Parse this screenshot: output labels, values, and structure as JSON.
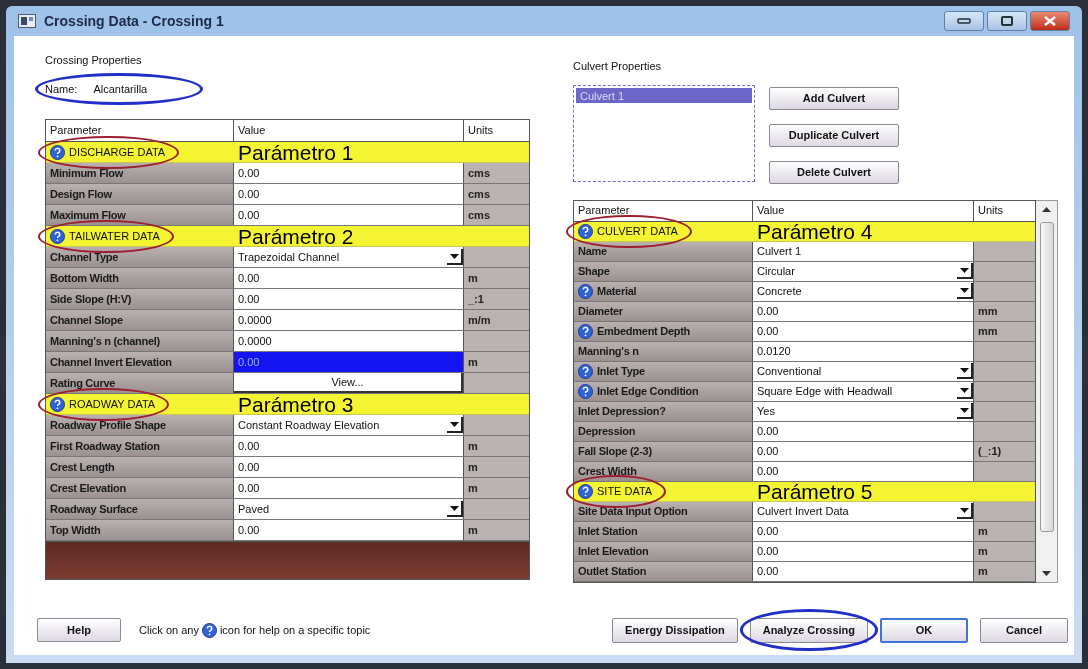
{
  "window": {
    "title": "Crossing Data - Crossing 1"
  },
  "crossing_properties": {
    "title": "Crossing Properties",
    "name_label": "Name:",
    "name": "Alcantarilla",
    "circled": true
  },
  "crossing_table": {
    "columns": [
      "Parameter",
      "Value",
      "Units"
    ],
    "rows": [
      {
        "kind": "header",
        "label": "DISCHARGE DATA",
        "annotation": "Parámetro 1",
        "circled": true,
        "help": true
      },
      {
        "kind": "text",
        "label": "Minimum Flow",
        "value": "0.00",
        "units": "cms",
        "help": false,
        "selected": false
      },
      {
        "kind": "text",
        "label": "Design Flow",
        "value": "0.00",
        "units": "cms",
        "help": false,
        "selected": false
      },
      {
        "kind": "text",
        "label": "Maximum Flow",
        "value": "0.00",
        "units": "cms",
        "help": false,
        "selected": false
      },
      {
        "kind": "header",
        "label": "TAILWATER DATA",
        "annotation": "Parámetro 2",
        "circled": true,
        "help": true
      },
      {
        "kind": "dropdown",
        "label": "Channel Type",
        "value": "Trapezoidal Channel",
        "help": false,
        "selected": false
      },
      {
        "kind": "text",
        "label": "Bottom Width",
        "value": "0.00",
        "units": "m",
        "help": false,
        "selected": false
      },
      {
        "kind": "text",
        "label": "Side Slope (H:V)",
        "value": "0.00",
        "units": "_:1",
        "help": false,
        "selected": false
      },
      {
        "kind": "text",
        "label": "Channel Slope",
        "value": "0.0000",
        "units": "m/m",
        "help": false,
        "selected": false
      },
      {
        "kind": "text",
        "label": "Manning's n (channel)",
        "value": "0.0000",
        "help": false,
        "selected": false
      },
      {
        "kind": "text",
        "label": "Channel Invert Elevation",
        "value": "0.00",
        "units": "m",
        "help": false,
        "selected": true
      },
      {
        "kind": "button",
        "label": "Rating Curve",
        "value": "View...",
        "help": false,
        "selected": false
      },
      {
        "kind": "header",
        "label": "ROADWAY DATA",
        "annotation": "Parámetro 3",
        "circled": true,
        "help": true
      },
      {
        "kind": "dropdown",
        "label": "Roadway Profile Shape",
        "value": "Constant Roadway Elevation",
        "help": false,
        "selected": false
      },
      {
        "kind": "text",
        "label": "First Roadway Station",
        "value": "0.00",
        "units": "m",
        "help": false,
        "selected": false
      },
      {
        "kind": "text",
        "label": "Crest Length",
        "value": "0.00",
        "units": "m",
        "help": false,
        "selected": false
      },
      {
        "kind": "text",
        "label": "Crest Elevation",
        "value": "0.00",
        "units": "m",
        "help": false,
        "selected": false
      },
      {
        "kind": "dropdown",
        "label": "Roadway Surface",
        "value": "Paved",
        "help": false,
        "selected": false
      },
      {
        "kind": "text",
        "label": "Top Width",
        "value": "0.00",
        "units": "m",
        "help": false,
        "selected": false
      }
    ]
  },
  "culvert_properties": {
    "title": "Culvert Properties",
    "culverts": [
      {
        "label": "Culvert 1",
        "selected": true
      }
    ],
    "buttons": [
      "Add Culvert",
      "Duplicate Culvert",
      "Delete Culvert"
    ]
  },
  "culvert_table": {
    "columns": [
      "Parameter",
      "Value",
      "Units"
    ],
    "rows": [
      {
        "kind": "header",
        "label": "CULVERT DATA",
        "annotation": "Parámetro 4",
        "circled": true,
        "help": true
      },
      {
        "kind": "text",
        "label": "Name",
        "value": "Culvert 1",
        "help": false,
        "selected": false
      },
      {
        "kind": "dropdown",
        "label": "Shape",
        "value": "Circular",
        "help": false,
        "selected": false
      },
      {
        "kind": "dropdown",
        "label": "Material",
        "value": "Concrete",
        "help": true,
        "selected": false
      },
      {
        "kind": "text",
        "label": "Diameter",
        "value": "0.00",
        "units": "mm",
        "help": false,
        "selected": false
      },
      {
        "kind": "text",
        "label": "Embedment Depth",
        "value": "0.00",
        "units": "mm",
        "help": true,
        "selected": false
      },
      {
        "kind": "text",
        "label": "Manning's n",
        "value": "0.0120",
        "help": false,
        "selected": false
      },
      {
        "kind": "dropdown",
        "label": "Inlet Type",
        "value": "Conventional",
        "help": true,
        "selected": false
      },
      {
        "kind": "dropdown",
        "label": "Inlet Edge Condition",
        "value": "Square Edge with Headwall",
        "help": true,
        "selected": false
      },
      {
        "kind": "dropdown",
        "label": "Inlet Depression?",
        "value": "Yes",
        "help": false,
        "selected": false
      },
      {
        "kind": "text",
        "label": "Depression",
        "value": "0.00",
        "help": false,
        "selected": false
      },
      {
        "kind": "text",
        "label": "Fall Slope (2-3)",
        "value": "0.00",
        "units": "(_:1)",
        "help": false,
        "selected": false
      },
      {
        "kind": "text",
        "label": "Crest Width",
        "value": "0.00",
        "help": false,
        "selected": false
      },
      {
        "kind": "header",
        "label": "SITE DATA",
        "annotation": "Parámetro 5",
        "circled": true,
        "help": true
      },
      {
        "kind": "dropdown",
        "label": "Site Data Input Option",
        "value": "Culvert Invert Data",
        "help": false,
        "selected": false
      },
      {
        "kind": "text",
        "label": "Inlet Station",
        "value": "0.00",
        "units": "m",
        "help": false,
        "selected": false
      },
      {
        "kind": "text",
        "label": "Inlet Elevation",
        "value": "0.00",
        "units": "m",
        "help": false,
        "selected": false
      },
      {
        "kind": "text",
        "label": "Outlet Station",
        "value": "0.00",
        "units": "m",
        "help": false,
        "selected": false
      }
    ]
  },
  "footer": {
    "help_button": "Help",
    "hint_before": "Click on any",
    "hint_after": "icon for help on a specific topic",
    "buttons": [
      {
        "label": "Energy Dissipation",
        "circled": false,
        "default": false
      },
      {
        "label": "Analyze Crossing",
        "circled": true,
        "default": false
      },
      {
        "label": "OK",
        "circled": false,
        "default": true
      },
      {
        "label": "Cancel",
        "circled": false,
        "default": false
      }
    ]
  }
}
